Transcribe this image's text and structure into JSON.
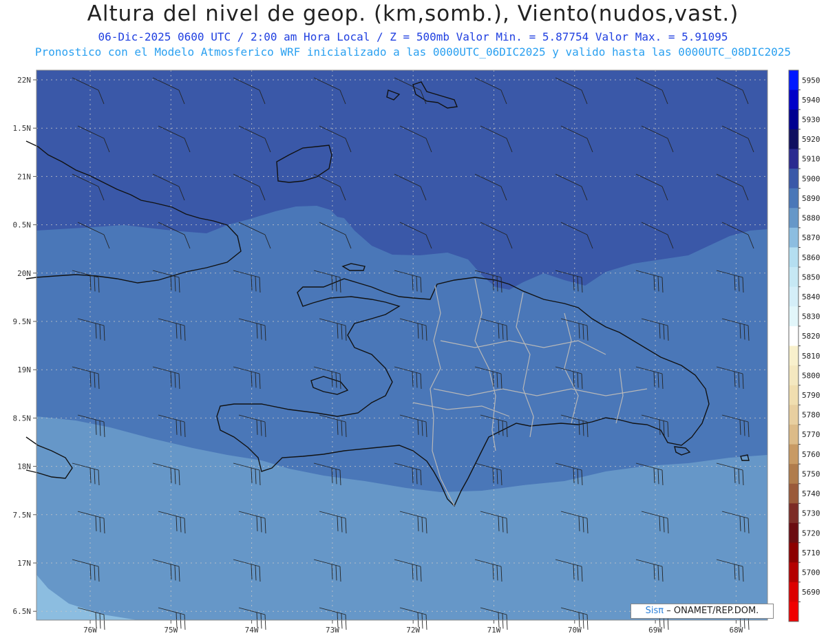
{
  "header": {
    "title": "Altura del nivel de geop. (km,somb.), Viento(nudos,vast.)",
    "subtitle_line1": "06-Dic-2025   0600 UTC / 2:00 am Hora Local / Z = 500mb     Valor Min. = 5.87754  Valor Max. = 5.91095",
    "subtitle_line2": "Pronostico con el Modelo Atmosferico WRF inicializado a las 0000UTC_06DIC2025 y valido hasta las  0000UTC_08DIC2025"
  },
  "map": {
    "lat_labels": [
      "22N",
      "1.5N",
      "21N",
      "0.5N",
      "20N",
      "9.5N",
      "19N",
      "8.5N",
      "18N",
      "7.5N",
      "17N",
      "6.5N"
    ],
    "lon_labels": [
      "76W",
      "75W",
      "74W",
      "73W",
      "72W",
      "71W",
      "70W",
      "69W",
      "68W"
    ],
    "fill_colors": {
      "5900_5910": "#3a58a8",
      "5890_5900": "#4a77b8",
      "5880_5890": "#6697c8",
      "5870_5880": "#8cbde0"
    }
  },
  "legend": {
    "levels": [
      "5950",
      "5940",
      "5930",
      "5920",
      "5910",
      "5900",
      "5890",
      "5880",
      "5870",
      "5860",
      "5850",
      "5840",
      "5830",
      "5820",
      "5810",
      "5800",
      "5790",
      "5780",
      "5770",
      "5760",
      "5750",
      "5740",
      "5730",
      "5720",
      "5710",
      "5700",
      "5690"
    ],
    "colors": [
      "#0018ff",
      "#0000c8",
      "#000090",
      "#101060",
      "#2a2a90",
      "#3a58a8",
      "#4a77b8",
      "#6697c8",
      "#8cbde0",
      "#b4def0",
      "#c6e8f4",
      "#d4eef8",
      "#e2f6fa",
      "#ffffff",
      "#f8f0cc",
      "#f4e8c0",
      "#f0deb0",
      "#e8cfa0",
      "#dcbb88",
      "#c89a64",
      "#b07c4c",
      "#9a5a3a",
      "#7c2c26",
      "#6a0c10",
      "#8c0000",
      "#b40000",
      "#dc0000",
      "#f00000"
    ]
  },
  "credit": {
    "sis": "Sisπ",
    "text": "– ONAMET/REP.DOM."
  }
}
